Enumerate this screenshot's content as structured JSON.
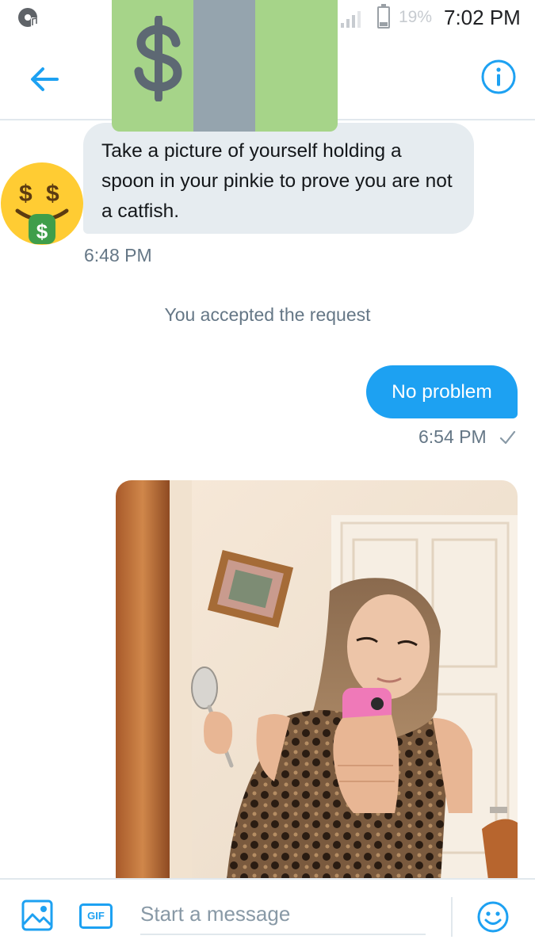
{
  "status_bar": {
    "battery": "19%",
    "time": "7:02 PM"
  },
  "header": {
    "back_icon": "arrow-left-icon",
    "info_icon": "info-circle-icon",
    "accent_color": "#1da1f2"
  },
  "conversation": {
    "incoming_message": {
      "text": "Take a picture of yourself holding a spoon in your pinkie to prove you are not a catfish.",
      "time": "6:48 PM"
    },
    "system_note": "You accepted the request",
    "outgoing_message": {
      "text": "No problem",
      "time": "6:54 PM",
      "status_icon": "check-icon"
    },
    "photo": {
      "icon": "selfie-photo"
    }
  },
  "composer": {
    "media_icon": "image-icon",
    "gif_label": "GIF",
    "placeholder": "Start a message",
    "emoji_icon": "smiley-icon"
  }
}
